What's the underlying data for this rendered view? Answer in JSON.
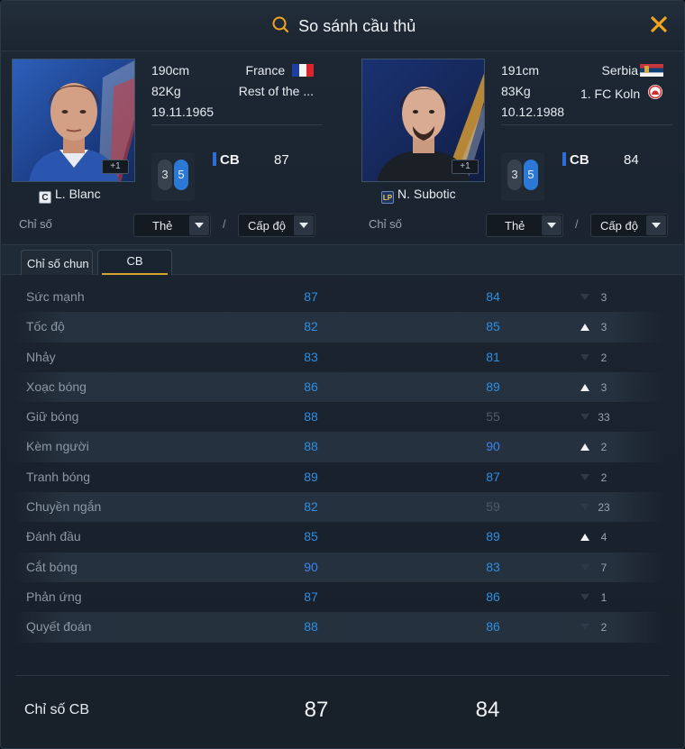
{
  "window": {
    "title": "So sánh cầu thủ",
    "title_icon": "search-icon",
    "close_icon": "close-icon",
    "accent": "#f0a520"
  },
  "players": [
    {
      "name": "L. Blanc",
      "card_badge": "C",
      "height": "190cm",
      "weight": "82Kg",
      "dob": "19.11.1965",
      "nation": "France",
      "club": "Rest of the ...",
      "upgrade_badge": "+1",
      "foot_left": "3",
      "foot_right": "5",
      "position": "CB",
      "rating": "87"
    },
    {
      "name": "N. Subotic",
      "card_badge": "LP",
      "height": "191cm",
      "weight": "83Kg",
      "dob": "10.12.1988",
      "nation": "Serbia",
      "club": "1. FC Koln",
      "upgrade_badge": "+1",
      "foot_left": "3",
      "foot_right": "5",
      "position": "CB",
      "rating": "84"
    }
  ],
  "filters": {
    "label": "Chỉ số",
    "card_select": "Thẻ",
    "level_select": "Cấp độ",
    "separator": "/"
  },
  "tabs": [
    {
      "label": "Chỉ số chun",
      "active": false
    },
    {
      "label": "CB",
      "active": true
    }
  ],
  "stats": [
    {
      "name": "Sức mạnh",
      "v1": "87",
      "v2": "84",
      "dir": "down",
      "diff": "3"
    },
    {
      "name": "Tốc độ",
      "v1": "82",
      "v2": "85",
      "dir": "up",
      "diff": "3"
    },
    {
      "name": "Nhảy",
      "v1": "83",
      "v2": "81",
      "dir": "down",
      "diff": "2"
    },
    {
      "name": "Xoạc bóng",
      "v1": "86",
      "v2": "89",
      "dir": "up",
      "diff": "3"
    },
    {
      "name": "Giữ bóng",
      "v1": "88",
      "v2": "55",
      "dir": "down",
      "diff": "33"
    },
    {
      "name": "Kèm người",
      "v1": "88",
      "v2": "90",
      "dir": "up",
      "diff": "2"
    },
    {
      "name": "Tranh bóng",
      "v1": "89",
      "v2": "87",
      "dir": "down",
      "diff": "2"
    },
    {
      "name": "Chuyền ngắn",
      "v1": "82",
      "v2": "59",
      "dir": "down",
      "diff": "23"
    },
    {
      "name": "Đánh đầu",
      "v1": "85",
      "v2": "89",
      "dir": "up",
      "diff": "4"
    },
    {
      "name": "Cắt bóng",
      "v1": "90",
      "v2": "83",
      "dir": "down",
      "diff": "7"
    },
    {
      "name": "Phản ứng",
      "v1": "87",
      "v2": "86",
      "dir": "down",
      "diff": "1"
    },
    {
      "name": "Quyết đoán",
      "v1": "88",
      "v2": "86",
      "dir": "down",
      "diff": "2"
    }
  ],
  "summary": {
    "label": "Chỉ số CB",
    "v1": "87",
    "v2": "84"
  }
}
